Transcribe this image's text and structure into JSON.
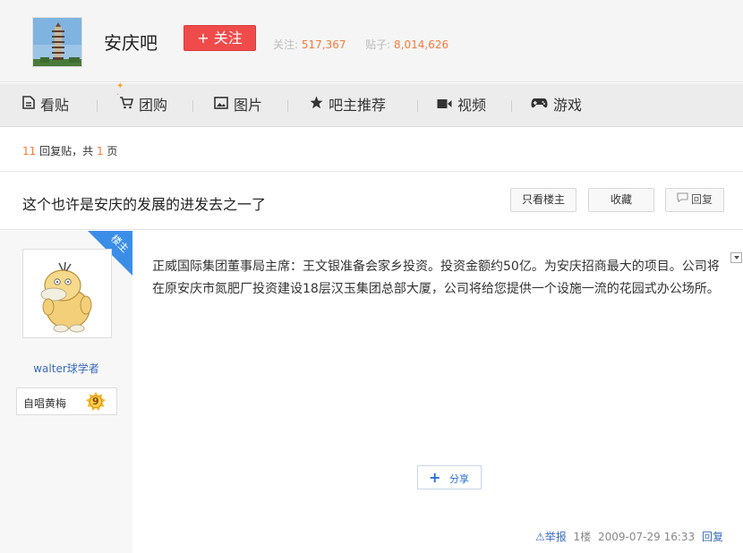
{
  "header": {
    "forum_name": "安庆吧",
    "follow_label": "+ 关注",
    "followers_label": "关注:",
    "followers_count": "517,367",
    "posts_label": "贴子:",
    "posts_count": "8,014,626"
  },
  "nav": {
    "items": [
      {
        "label": "看贴",
        "icon": "document-icon"
      },
      {
        "label": "团购",
        "icon": "cart-icon"
      },
      {
        "label": "图片",
        "icon": "image-icon"
      },
      {
        "label": "吧主推荐",
        "icon": "star-icon"
      },
      {
        "label": "视频",
        "icon": "video-icon"
      },
      {
        "label": "游戏",
        "icon": "gamepad-icon"
      }
    ]
  },
  "reply_bar": {
    "reply_count": "11",
    "reply_text": "回复贴，共",
    "page_count": "1",
    "page_text": "页"
  },
  "thread": {
    "title": "这个也许是安庆的发展的进发去之一了",
    "only_op_label": "只看楼主",
    "favorite_label": "收藏",
    "reply_label": "回复"
  },
  "post": {
    "op_badge": "楼主",
    "author_name": "walter球学者",
    "level_name": "自唱黄梅",
    "level_number": "9",
    "content": "正威国际集团董事局主席：王文银准备会家乡投资。投资金额约50亿。为安庆招商最大的项目。公司将在原安庆市氮肥厂投资建设18层汉玉集团总部大厦，公司将给您提供一个设施一流的花园式办公场所。",
    "share_label": "分享",
    "report_label": "举报",
    "floor": "1楼",
    "timestamp": "2009-07-29 16:33",
    "reply_label": "回复"
  },
  "colors": {
    "accent_orange": "#f57a3a",
    "follow_red": "#f04b4b",
    "link_blue": "#3a6cbe",
    "op_badge_blue": "#3b8ee8"
  }
}
